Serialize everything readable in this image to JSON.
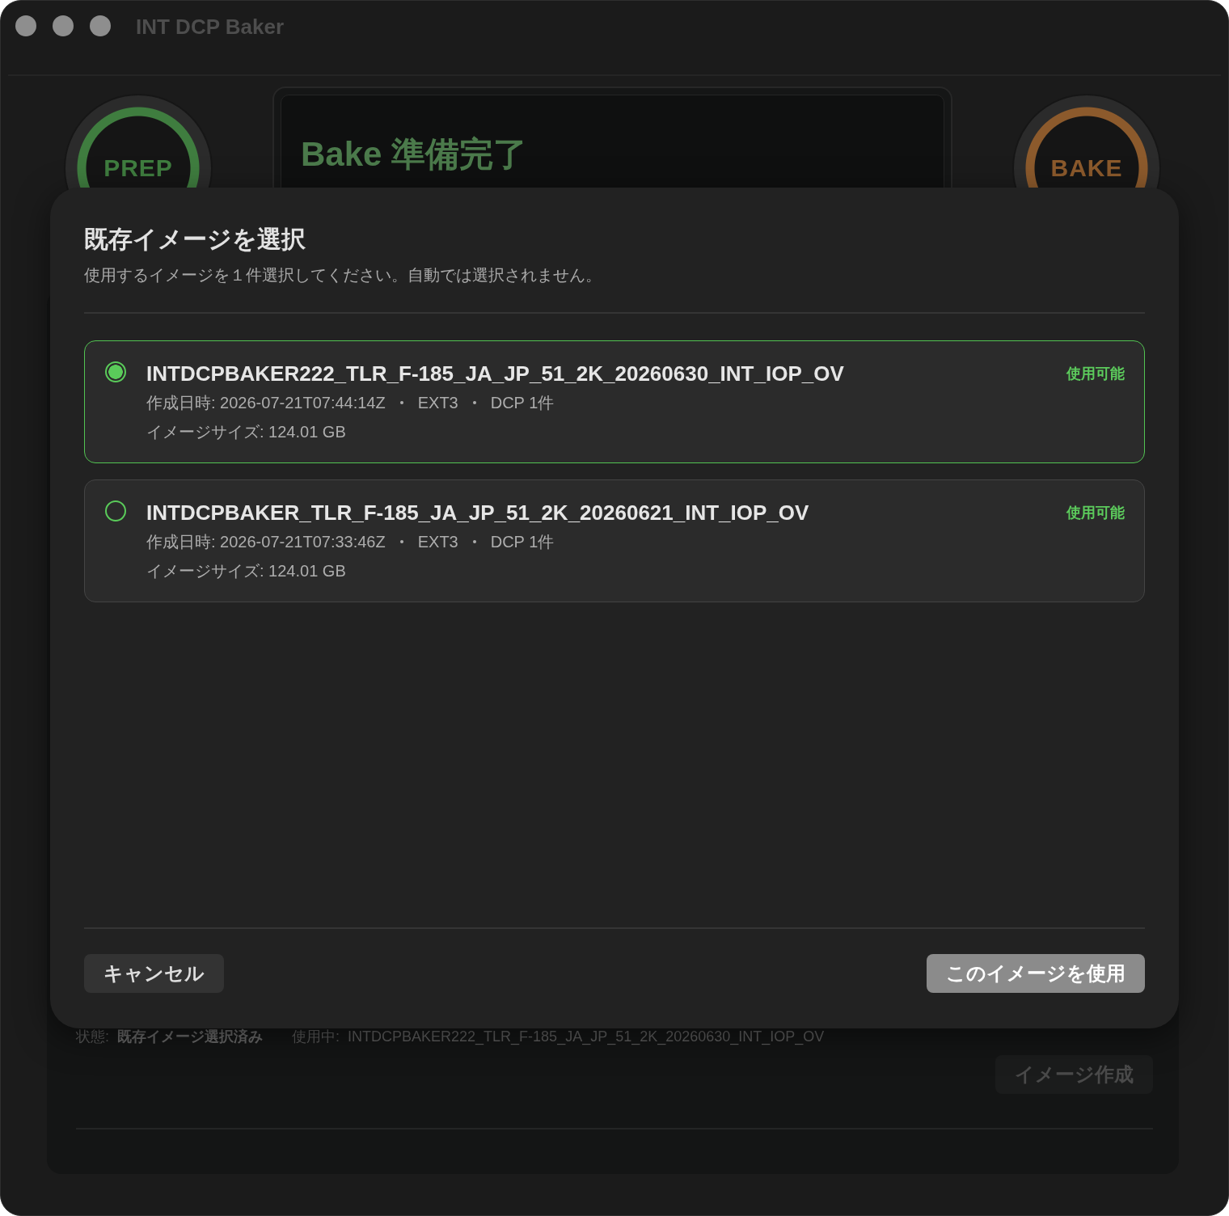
{
  "window": {
    "title": "INT DCP Baker"
  },
  "stage_buttons": [
    {
      "label": "PREP",
      "color": "#3f7d3f"
    },
    {
      "label": "BAKE",
      "color": "#8c5a2c"
    }
  ],
  "display": {
    "title": "Bake 準備完了"
  },
  "status_bar": {
    "status_label": "状態:",
    "status_value": "既存イメージ選択済み",
    "in_use_label": "使用中:",
    "in_use_value": "INTDCPBAKER222_TLR_F-185_JA_JP_51_2K_20260630_INT_IOP_OV"
  },
  "create_button": {
    "label": "イメージ作成",
    "disabled": true
  },
  "dialog": {
    "title": "既存イメージを選択",
    "subtitle": "使用するイメージを１件選択してください。自動では選択されません。",
    "images": [
      {
        "name": "INTDCPBAKER222_TLR_F-185_JA_JP_51_2K_20260630_INT_IOP_OV",
        "created": "作成日時: 2026-07-21T07:44:14Z",
        "filesystem": "EXT3",
        "dcp_count": "DCP 1件",
        "size": "イメージサイズ: 124.01 GB",
        "status": "使用可能",
        "selected": true
      },
      {
        "name": "INTDCPBAKER_TLR_F-185_JA_JP_51_2K_20260621_INT_IOP_OV",
        "created": "作成日時: 2026-07-21T07:33:46Z",
        "filesystem": "EXT3",
        "dcp_count": "DCP 1件",
        "size": "イメージサイズ: 124.01 GB",
        "status": "使用可能",
        "selected": false
      }
    ],
    "cancel_button": "キャンセル",
    "confirm_button": "このイメージを使用"
  }
}
